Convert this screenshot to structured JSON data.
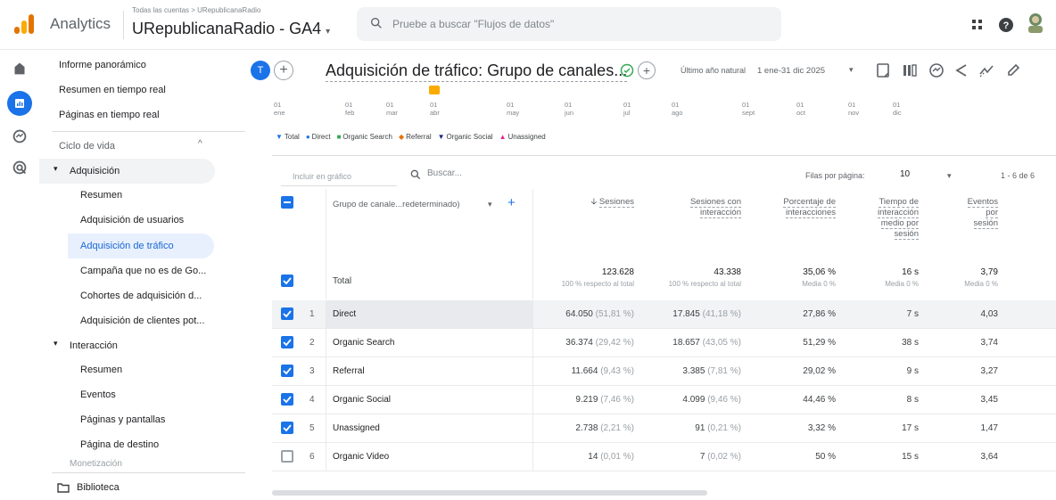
{
  "topbar": {
    "brand": "Analytics",
    "account_crumb": "Todas las cuentas > URepublicanaRadio",
    "account_name": "URepublicanaRadio - GA4",
    "search_placeholder": "Pruebe a buscar \"Flujos de datos\""
  },
  "nav": {
    "items": [
      {
        "label": "Informe panorámico"
      },
      {
        "label": "Resumen en tiempo real"
      },
      {
        "label": "Páginas en tiempo real"
      },
      {
        "label": "Ciclo de vida"
      },
      {
        "label": "Adquisición"
      },
      {
        "label": "Resumen"
      },
      {
        "label": "Adquisición de usuarios"
      },
      {
        "label": "Adquisición de tráfico"
      },
      {
        "label": "Campaña que no es de Go..."
      },
      {
        "label": "Cohortes de adquisición d..."
      },
      {
        "label": "Adquisición de clientes pot..."
      },
      {
        "label": "Interacción"
      },
      {
        "label": "Resumen"
      },
      {
        "label": "Eventos"
      },
      {
        "label": "Páginas y pantallas"
      },
      {
        "label": "Página de destino"
      },
      {
        "label": "Monetización"
      },
      {
        "label": "Biblioteca"
      }
    ]
  },
  "header": {
    "avatar_letter": "T",
    "title": "Adquisición de tráfico: Grupo de canales...",
    "date_label": "Último año natural",
    "date_range": "1 ene-31 dic 2025"
  },
  "chart": {
    "ticks": [
      {
        "d": "01",
        "m": "ene"
      },
      {
        "d": "01",
        "m": "feb"
      },
      {
        "d": "01",
        "m": "mar"
      },
      {
        "d": "01",
        "m": "abr"
      },
      {
        "d": "01",
        "m": "may"
      },
      {
        "d": "01",
        "m": "jun"
      },
      {
        "d": "01",
        "m": "jul"
      },
      {
        "d": "01",
        "m": "ago"
      },
      {
        "d": "01",
        "m": "sept"
      },
      {
        "d": "01",
        "m": "oct"
      },
      {
        "d": "01",
        "m": "nov"
      },
      {
        "d": "01",
        "m": "dic"
      }
    ],
    "legend": [
      "Total",
      "Direct",
      "Organic Search",
      "Referral",
      "Organic Social",
      "Unassigned"
    ],
    "legend_colors": [
      "#1a73e8",
      "#1a73e8",
      "#34a853",
      "#e8710a",
      "#1a237e",
      "#e52592"
    ]
  },
  "table": {
    "include_placeholder": "Incluir en gráfico",
    "search_placeholder": "Buscar...",
    "rows_per_page_label": "Filas por página:",
    "rows_per_page": "10",
    "range": "1 - 6 de 6",
    "dimension_header": "Grupo de canale...redeterminado)",
    "headers": {
      "sessions": "Sesiones",
      "engaged_1": "Sesiones con",
      "engaged_2": "interacción",
      "rate_1": "Porcentaje de",
      "rate_2": "interacciones",
      "time_1": "Tiempo de",
      "time_2": "interacción",
      "time_3": "medio por",
      "time_4": "sesión",
      "events_1": "Eventos",
      "events_2": "por",
      "events_3": "sesión"
    },
    "total": {
      "label": "Total",
      "sessions": "123.628",
      "sessions_sub": "100 % respecto al total",
      "engaged": "43.338",
      "engaged_sub": "100 % respecto al total",
      "rate": "35,06 %",
      "rate_sub": "Media 0 %",
      "time": "16 s",
      "time_sub": "Media 0 %",
      "events": "3,79",
      "events_sub": "Media 0 %"
    },
    "rows": [
      {
        "idx": "1",
        "name": "Direct",
        "sessions": "64.050",
        "sessions_pct": "(51,81 %)",
        "engaged": "17.845",
        "engaged_pct": "(41,18 %)",
        "rate": "27,86 %",
        "time": "7 s",
        "events": "4,03"
      },
      {
        "idx": "2",
        "name": "Organic Search",
        "sessions": "36.374",
        "sessions_pct": "(29,42 %)",
        "engaged": "18.657",
        "engaged_pct": "(43,05 %)",
        "rate": "51,29 %",
        "time": "38 s",
        "events": "3,74"
      },
      {
        "idx": "3",
        "name": "Referral",
        "sessions": "11.664",
        "sessions_pct": "(9,43 %)",
        "engaged": "3.385",
        "engaged_pct": "(7,81 %)",
        "rate": "29,02 %",
        "time": "9 s",
        "events": "3,27"
      },
      {
        "idx": "4",
        "name": "Organic Social",
        "sessions": "9.219",
        "sessions_pct": "(7,46 %)",
        "engaged": "4.099",
        "engaged_pct": "(9,46 %)",
        "rate": "44,46 %",
        "time": "8 s",
        "events": "3,45"
      },
      {
        "idx": "5",
        "name": "Unassigned",
        "sessions": "2.738",
        "sessions_pct": "(2,21 %)",
        "engaged": "91",
        "engaged_pct": "(0,21 %)",
        "rate": "3,32 %",
        "time": "17 s",
        "events": "1,47"
      },
      {
        "idx": "6",
        "name": "Organic Video",
        "sessions": "14",
        "sessions_pct": "(0,01 %)",
        "engaged": "7",
        "engaged_pct": "(0,02 %)",
        "rate": "50 %",
        "time": "15 s",
        "events": "3,64"
      }
    ]
  }
}
